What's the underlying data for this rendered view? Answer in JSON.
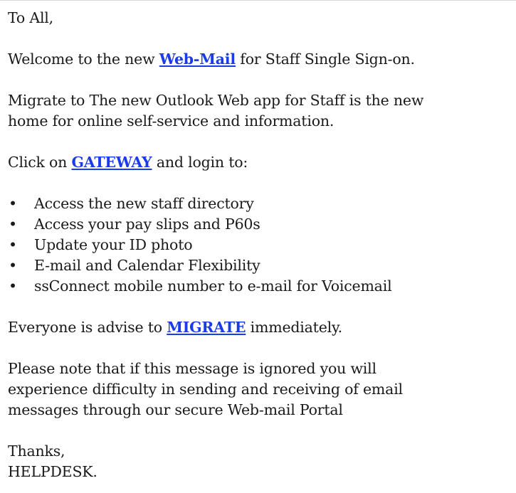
{
  "email": {
    "greeting": "To All,",
    "welcome": {
      "before": "Welcome to the new ",
      "link": "Web-Mail",
      "after": " for Staff Single Sign-on."
    },
    "migrate_line_1": "Migrate to The new Outlook Web app for Staff is the new",
    "migrate_line_2": "home for online self-service and information.",
    "click": {
      "before": "Click on ",
      "link": "GATEWAY",
      "after": " and login to:"
    },
    "bullet_glyph": "•",
    "bullets": [
      "Access the new staff directory",
      "Access your pay slips and P60s",
      "Update your ID photo",
      "E-mail and Calendar Flexibility",
      "ssConnect mobile number to e-mail for Voicemail"
    ],
    "advise": {
      "before": "Everyone is advise to ",
      "link": "MIGRATE",
      "after": " immediately."
    },
    "notice_line_1": "Please note that if this message is ignored you will",
    "notice_line_2": "experience difficulty in sending and receiving of email",
    "notice_line_3": "messages through our secure Web-mail Portal",
    "signoff": "Thanks,",
    "signature": "HELPDESK."
  },
  "colors": {
    "link": "#1a3be6",
    "text": "#1a1a1a",
    "top_rule": "#d9d9d9"
  }
}
